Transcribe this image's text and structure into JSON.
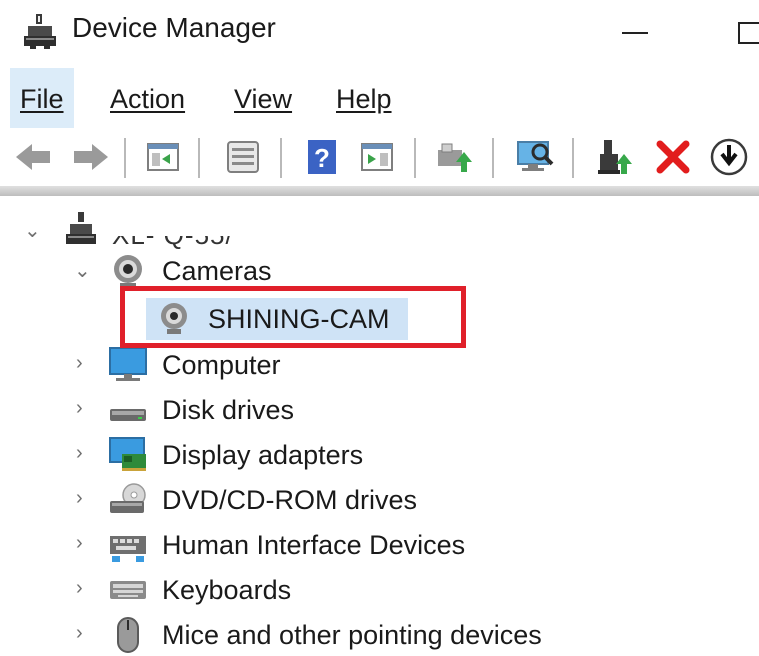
{
  "window": {
    "title": "Device Manager",
    "icons": {
      "app": "device-manager-icon",
      "minimize": "minimize-icon",
      "maximize": "maximize-icon"
    }
  },
  "menu": {
    "items": [
      {
        "id": "file",
        "label": "File",
        "active": true
      },
      {
        "id": "action",
        "label": "Action"
      },
      {
        "id": "view",
        "label": "View"
      },
      {
        "id": "help",
        "label": "Help"
      }
    ]
  },
  "toolbar": {
    "buttons": [
      {
        "icon": "back-arrow-icon"
      },
      {
        "icon": "forward-arrow-icon"
      },
      {
        "icon": "show-hide-console-tree-icon"
      },
      {
        "icon": "properties-icon"
      },
      {
        "icon": "help-icon"
      },
      {
        "icon": "show-action-pane-icon"
      },
      {
        "icon": "update-driver-icon"
      },
      {
        "icon": "scan-hardware-changes-icon"
      },
      {
        "icon": "enable-device-icon"
      },
      {
        "icon": "uninstall-device-icon"
      },
      {
        "icon": "disable-device-icon"
      }
    ]
  },
  "tree": {
    "root": {
      "label": "XL-     Q-55/",
      "icon": "computer-root-icon",
      "expanded": true
    },
    "nodes": [
      {
        "id": "cameras",
        "label": "Cameras",
        "icon": "camera-icon",
        "expanded": true
      },
      {
        "id": "shining-cam",
        "label": "SHINING-CAM",
        "icon": "webcam-icon",
        "selected": true,
        "highlighted": true
      },
      {
        "id": "computer",
        "label": "Computer",
        "icon": "monitor-icon",
        "expanded": false
      },
      {
        "id": "disk-drives",
        "label": "Disk drives",
        "icon": "disk-drive-icon",
        "expanded": false
      },
      {
        "id": "display-adapters",
        "label": "Display adapters",
        "icon": "display-adapter-icon",
        "expanded": false
      },
      {
        "id": "dvd-cd-rom-drives",
        "label": "DVD/CD-ROM drives",
        "icon": "dvd-drive-icon",
        "expanded": false
      },
      {
        "id": "human-interface-devices",
        "label": "Human Interface Devices",
        "icon": "hid-icon",
        "expanded": false
      },
      {
        "id": "keyboards",
        "label": "Keyboards",
        "icon": "keyboard-icon",
        "expanded": false
      },
      {
        "id": "mice",
        "label": "Mice and other pointing devices",
        "icon": "mouse-icon",
        "expanded": false
      }
    ]
  },
  "colors": {
    "highlight_border": "#e0202a",
    "selection": "#cfe3f6",
    "menu_active": "#dcecf9"
  }
}
